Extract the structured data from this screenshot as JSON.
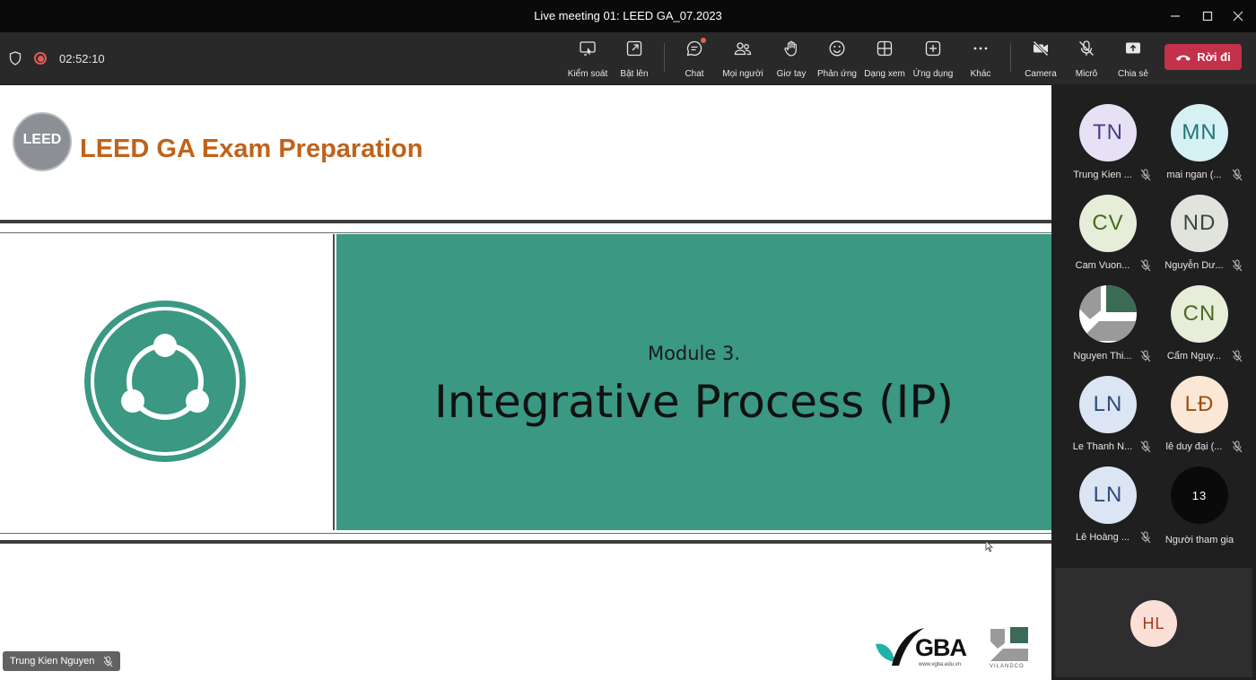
{
  "window": {
    "title": "Live meeting 01: LEED GA_07.2023"
  },
  "toolbar": {
    "timer": "02:52:10",
    "buttons": [
      {
        "label": "Kiểm soát",
        "icon": "take-control-icon"
      },
      {
        "label": "Bật lên",
        "icon": "pop-out-icon"
      },
      {
        "label": "Chat",
        "icon": "chat-icon"
      },
      {
        "label": "Mọi người",
        "icon": "people-icon"
      },
      {
        "label": "Giơ tay",
        "icon": "raise-hand-icon"
      },
      {
        "label": "Phản ứng",
        "icon": "react-icon"
      },
      {
        "label": "Dạng xem",
        "icon": "view-icon"
      },
      {
        "label": "Ứng dụng",
        "icon": "apps-icon"
      },
      {
        "label": "Khác",
        "icon": "more-icon"
      },
      {
        "label": "Camera",
        "icon": "camera-off-icon"
      },
      {
        "label": "Micrô",
        "icon": "mic-off-icon"
      },
      {
        "label": "Chia sẻ",
        "icon": "share-icon"
      }
    ],
    "leave_label": "Rời đi",
    "leave_color": "#c4314b"
  },
  "slide": {
    "logo_text": "LEED",
    "title": "LEED GA Exam Preparation",
    "module": "Module 3.",
    "heading": "Integrative Process (IP)",
    "accent": "#3a9883",
    "title_color": "#c0621a",
    "sponsor_gba": "GBA",
    "sponsor_gba_url": "www.vgba.edu.vn",
    "sponsor_vilandco": "VILANDCO"
  },
  "presenter_label": "Trung Kien Nguyen",
  "participants": [
    {
      "initials": "TN",
      "name": "Trung Kien ...",
      "bg": "#e6e1f5",
      "fg": "#4b3f86"
    },
    {
      "initials": "MN",
      "name": "mai ngan (...",
      "bg": "#d6f1f3",
      "fg": "#24727a"
    },
    {
      "initials": "CV",
      "name": "Cam Vuon...",
      "bg": "#e6eed9",
      "fg": "#4a6a21"
    },
    {
      "initials": "ND",
      "name": "Nguyễn Dư...",
      "bg": "#e0e4dc",
      "fg": "#3c4a34"
    },
    {
      "initials": "",
      "name": "Nguyen Thi...",
      "bg": "#ffffff",
      "fg": "#2d5c46",
      "image": true
    },
    {
      "initials": "CN",
      "name": "Cẩm Nguy...",
      "bg": "#e6eed9",
      "fg": "#4a6a21"
    },
    {
      "initials": "LN",
      "name": "Le Thanh N...",
      "bg": "#dbe5f3",
      "fg": "#2c4b7a"
    },
    {
      "initials": "LĐ",
      "name": "lê duy đại (...",
      "bg": "#fbe7d5",
      "fg": "#9a4e12"
    },
    {
      "initials": "LN",
      "name": "Lê Hoàng ...",
      "bg": "#dbe5f3",
      "fg": "#2c4b7a"
    }
  ],
  "more_participants": {
    "count": "13",
    "label": "Người tham gia"
  },
  "self_view": {
    "initials": "HL"
  }
}
